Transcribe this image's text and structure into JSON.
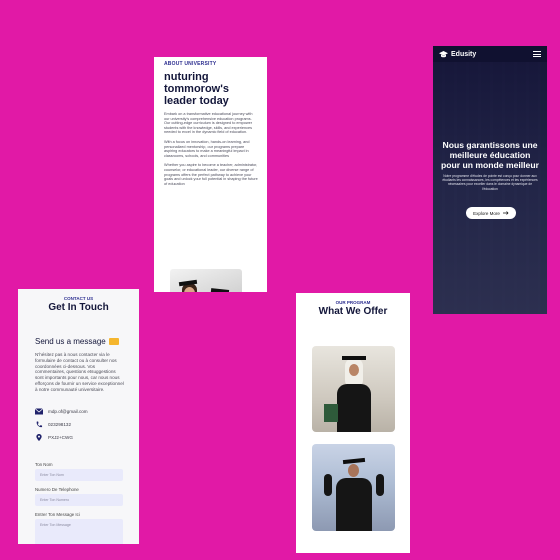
{
  "about": {
    "eyebrow": "ABOUT UNIVERSITY",
    "title": "nuturing tommorow's leader today",
    "para1": "Embark on a transformative educational journey with our university's comprehensive education programs. Our cutting-edge curriculum is designed to empower students with the knowledge, skills, and experiences needed to excel in the dynamic field of education.",
    "para2": "With a focus on innovation, hands-on learning, and personalized mentorship, our programs prepare aspiring educators to make a meaningful impact in classrooms, schools, and communities",
    "para3": "Whether you aspire to become a teacher, administrator, counselor, or educational leader, our diverse range of programs offers the perfect pathway to achieve your goals and unlock your full potential in shaping the future of education",
    "image_icon": "play-icon"
  },
  "hero": {
    "brand": "Edusity",
    "title": "Nous garantissons une meilleure éducation pour un monde meilleur",
    "subtitle": "Notre programme d'études de pointe est conçu pour donner aux étudiants les connaissances, les compétences et les expériences nécessaires pour exceller dans le domaine dynamique de l'éducation",
    "cta_label": "Explore More",
    "cta_icon": "arrow-right-icon",
    "menu_icon": "hamburger-icon",
    "logo_icon": "graduation-cap-icon"
  },
  "contact": {
    "eyebrow": "CONTACT US",
    "title": "Get In Touch",
    "send_title": "Send us a message",
    "send_icon": "envelope-icon",
    "intro": "N'hésitez pas à nous contacter via le formulaire de contact ou à consulter nos coordonnées ci-dessous. Vos commentaires, questions etsuggestions sont importants pour nous, car nous nous efforçons de fournir un service exceptionnel à notre communauté universitaire.",
    "email": "mdp.of@gmail.com",
    "phone": "023298132",
    "location": "PXJ2+CWG",
    "name_label": "Ton Nom",
    "name_placeholder": "Enter Ton Nom",
    "phone_label": "Numero De Telephone",
    "phone_placeholder": "Enter Ton Numero",
    "message_label": "Entrer Ton Message Ici",
    "message_placeholder": "Enter Ton Message"
  },
  "offer": {
    "eyebrow": "OUR PROGRAM",
    "title": "What We Offer"
  },
  "colors": {
    "background": "#e119a6",
    "accent": "#2b2d8f",
    "hero_bg": "#191a3b",
    "field_bg": "#e9eafb"
  }
}
